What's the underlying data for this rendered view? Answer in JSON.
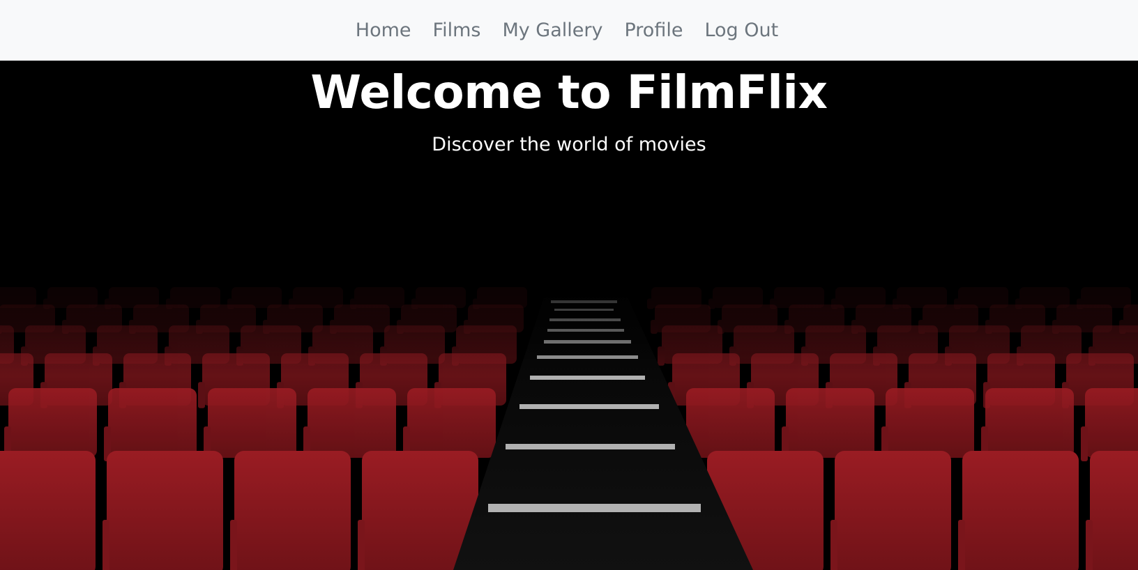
{
  "nav": {
    "items": [
      {
        "label": "Home"
      },
      {
        "label": "Films"
      },
      {
        "label": "My Gallery"
      },
      {
        "label": "Profile"
      },
      {
        "label": "Log Out"
      }
    ]
  },
  "hero": {
    "title": "Welcome to FilmFlix",
    "subtitle": "Discover the world of movies",
    "image": "cinema-seats-photo"
  },
  "colors": {
    "navbar_bg": "#f8f9fa",
    "nav_link": "#6c757d",
    "seat_red": "#8e1a20",
    "background": "#000000",
    "text": "#ffffff"
  }
}
